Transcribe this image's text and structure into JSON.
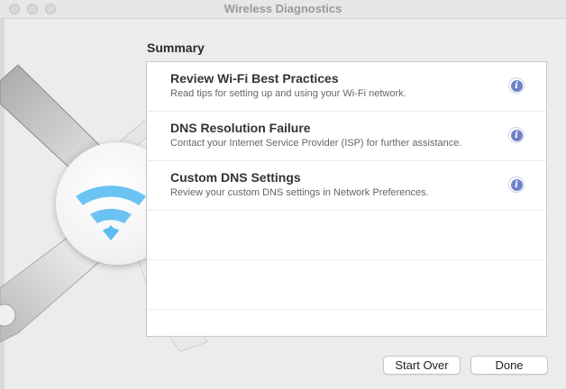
{
  "window": {
    "title": "Wireless Diagnostics"
  },
  "summary": {
    "heading": "Summary",
    "items": [
      {
        "title": "Review Wi-Fi Best Practices",
        "description": "Read tips for setting up and using your Wi-Fi network.",
        "icon": "info-icon"
      },
      {
        "title": "DNS Resolution Failure",
        "description": "Contact your Internet Service Provider (ISP) for further assistance.",
        "icon": "info-icon"
      },
      {
        "title": "Custom DNS Settings",
        "description": "Review your custom DNS settings in Network Preferences.",
        "icon": "info-icon"
      }
    ]
  },
  "buttons": {
    "start_over": "Start Over",
    "done": "Done"
  },
  "colors": {
    "info_accent": "#6f82c9",
    "wifi_blue": "#5bbcf2"
  }
}
